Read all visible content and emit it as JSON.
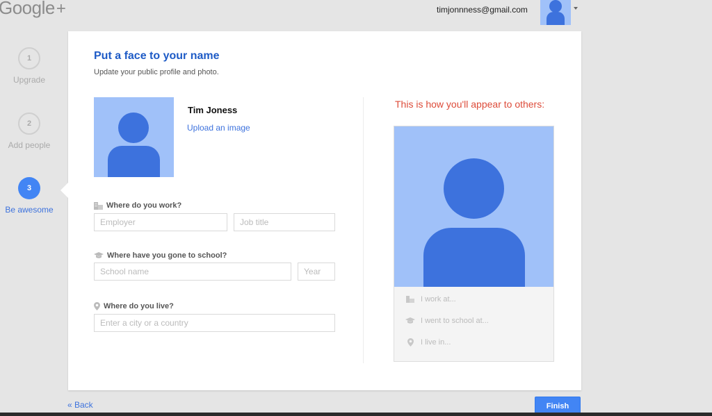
{
  "header": {
    "logo_text": "Google",
    "logo_plus": "+",
    "account_email": "timjonnness@gmail.com"
  },
  "steps": [
    {
      "number": "1",
      "label": "Upgrade",
      "state": "done"
    },
    {
      "number": "2",
      "label": "Add people",
      "state": "done"
    },
    {
      "number": "3",
      "label": "Be awesome",
      "state": "active"
    }
  ],
  "card": {
    "title": "Put a face to your name",
    "subtitle": "Update your public profile and photo.",
    "profile_name": "Tim Joness",
    "upload_link": "Upload an image"
  },
  "form": {
    "work": {
      "label": "Where do you work?",
      "employer_placeholder": "Employer",
      "jobtitle_placeholder": "Job title",
      "icon": "building-icon"
    },
    "school": {
      "label": "Where have you gone to school?",
      "school_placeholder": "School name",
      "year_placeholder": "Year",
      "icon": "graduation-cap-icon"
    },
    "live": {
      "label": "Where do you live?",
      "city_placeholder": "Enter a city or a country",
      "icon": "location-pin-icon"
    }
  },
  "preview": {
    "title": "This is how you'll appear to others:",
    "work_line": "I work at...",
    "school_line": "I went to school at...",
    "live_line": "I live in..."
  },
  "footer": {
    "back_label": "« Back",
    "finish_label": "Finish"
  },
  "colors": {
    "accent": "#4285f4",
    "title_blue": "#1e5bc6",
    "preview_red": "#dd4b39",
    "avatar_bg": "#a0c1f9",
    "avatar_fg": "#3d72dd"
  }
}
